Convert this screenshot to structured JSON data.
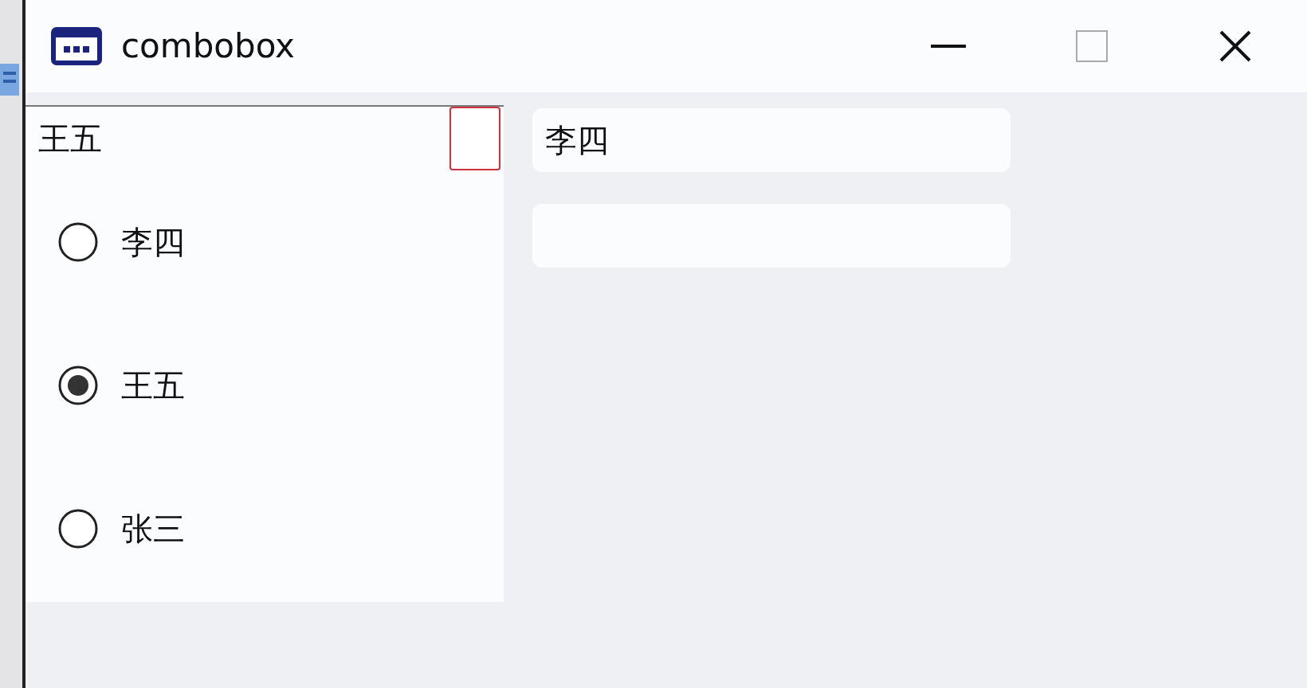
{
  "window": {
    "title": "combobox"
  },
  "combobox": {
    "value": "王五"
  },
  "options": [
    {
      "label": "李四",
      "selected": false
    },
    {
      "label": "王五",
      "selected": true
    },
    {
      "label": "张三",
      "selected": false
    }
  ],
  "fields": [
    {
      "kind": "text",
      "value": "李四"
    },
    {
      "kind": "blank"
    }
  ]
}
